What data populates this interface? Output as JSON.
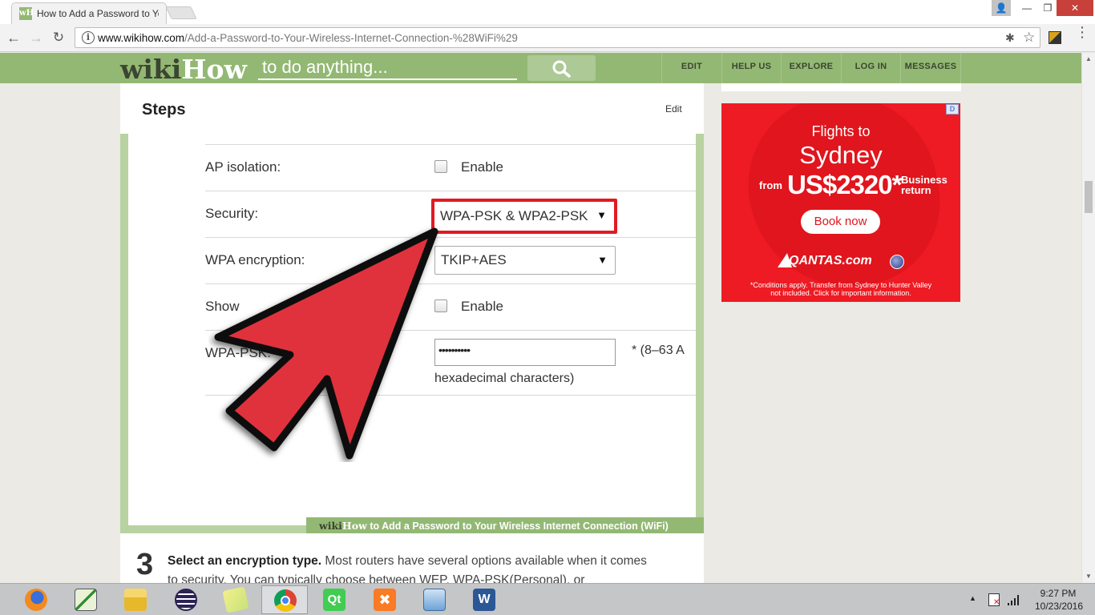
{
  "browser": {
    "tab_title": "How to Add a Password to Your Wireless Internet Connection (WiFi)",
    "favicon_text": "wH",
    "url_host": "www.wikihow.com",
    "url_path": "/Add-a-Password-to-Your-Wireless-Internet-Connection-%28WiFi%29"
  },
  "wikihow": {
    "logo_wiki": "wiki",
    "logo_how": "How",
    "search_placeholder": "to do anything...",
    "nav": [
      "EDIT",
      "HELP US",
      "EXPLORE",
      "LOG IN",
      "MESSAGES"
    ],
    "accent_color": "#93b874"
  },
  "article": {
    "section_title": "Steps",
    "section_edit": "Edit",
    "screenshot": {
      "ap_isolation_label": "AP isolation:",
      "ap_isolation_check": "Enable",
      "security_label": "Security:",
      "security_value": "WPA-PSK & WPA2-PSK",
      "wpa_encryption_label": "WPA encryption:",
      "wpa_encryption_value": "TKIP+AES",
      "show_label": "Show",
      "show_check": "Enable",
      "psk_label": "WPA-PSK:",
      "psk_value": "••••••••••",
      "psk_note": "*   (8–63 A",
      "psk_note2": "hexadecimal characters)",
      "highlight_color": "#e01b24"
    },
    "watermark_wiki": "wiki",
    "watermark_how": "How",
    "watermark_text": " to Add a Password to Your Wireless Internet Connection (WiFi)",
    "step3_number": "3",
    "step3_bold": "Select an encryption type.",
    "step3_text": " Most routers have several options available when it comes to security. You can typically choose between WEP, WPA-PSK(Personal), or"
  },
  "ad": {
    "badge": "D",
    "flights_to": "Flights to",
    "city": "Sydney",
    "from": "from",
    "price": "US$2320*",
    "class_line1": "Business",
    "class_line2": "return",
    "cta": "Book now",
    "brand": "QANTAS.com",
    "terms_line1": "*Conditions apply. Transfer from Sydney to Hunter Valley",
    "terms_line2": "not included. Click for important information.",
    "background_color": "#ee1b24"
  },
  "taskbar": {
    "apps": [
      "firefox",
      "task-manager",
      "file-explorer",
      "eclipse",
      "sticky-notes",
      "chrome",
      "qt-creator",
      "xampp",
      "control-panel",
      "word"
    ],
    "time": "9:27 PM",
    "date": "10/23/2016"
  }
}
